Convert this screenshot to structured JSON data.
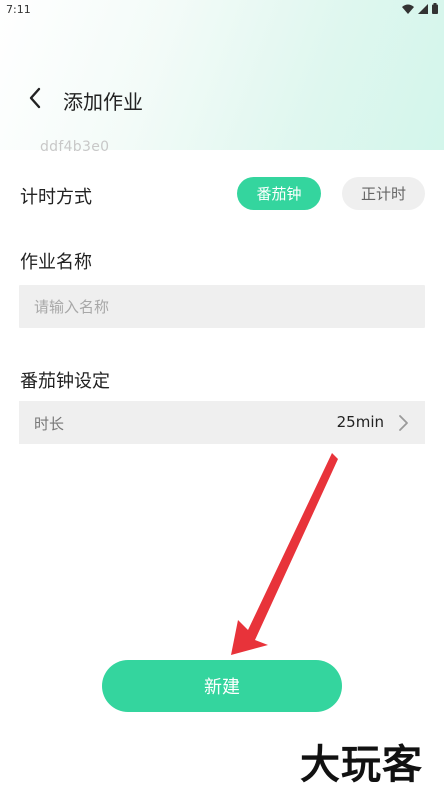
{
  "status_bar": {
    "time": "7:11"
  },
  "header": {
    "title": "添加作业"
  },
  "watermark_id": "ddf4b3e0",
  "timer_mode": {
    "label": "计时方式",
    "options": [
      "番茄钟",
      "正计时"
    ],
    "selected": "番茄钟"
  },
  "homework_name": {
    "label": "作业名称",
    "placeholder": "请输入名称",
    "value": ""
  },
  "pomodoro_settings": {
    "label": "番茄钟设定",
    "duration_label": "时长",
    "duration_value": "25min"
  },
  "create_button": {
    "label": "新建"
  },
  "brand_watermark": "大玩客",
  "colors": {
    "accent": "#34d59e",
    "chip_inactive_bg": "#efefef",
    "field_bg": "#efefef",
    "arrow": "#e8333a"
  },
  "icons": {
    "back": "chevron-left-icon",
    "duration_chevron": "chevron-right-icon",
    "wifi": "wifi-icon",
    "signal": "signal-icon",
    "battery": "battery-icon"
  }
}
